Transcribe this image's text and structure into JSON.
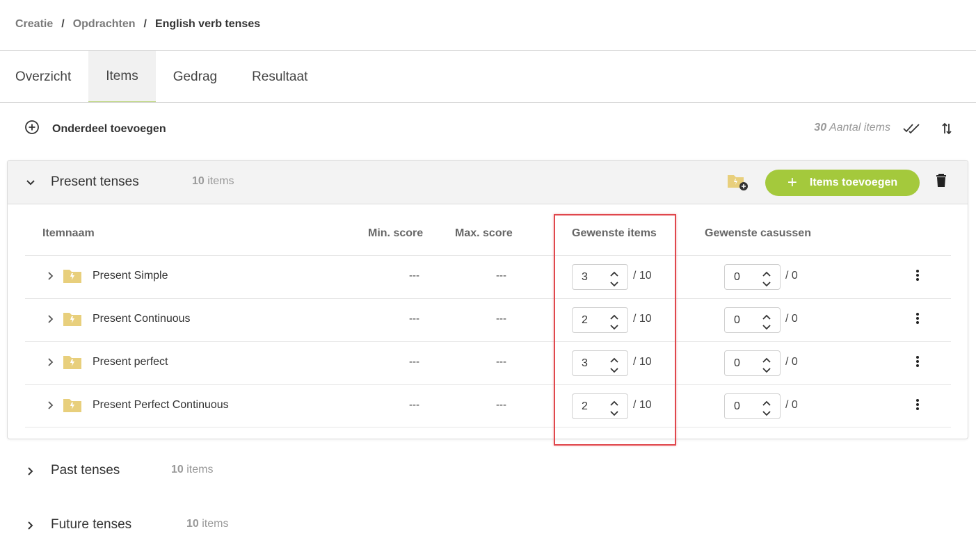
{
  "breadcrumb": {
    "items": [
      "Creatie",
      "Opdrachten",
      "English verb tenses"
    ],
    "separator": "/"
  },
  "tabs": [
    "Overzicht",
    "Items",
    "Gedrag",
    "Resultaat"
  ],
  "active_tab": "Items",
  "toolbar": {
    "add_section_label": "Onderdeel toevoegen",
    "item_count": "30",
    "item_count_label": "Aantal items"
  },
  "sections": [
    {
      "title": "Present tenses",
      "count": "10",
      "count_label": "items",
      "expanded": true,
      "add_items_label": "Items toevoegen",
      "columns": [
        "Itemnaam",
        "Min. score",
        "Max. score",
        "Gewenste items",
        "Gewenste casussen"
      ],
      "rows": [
        {
          "name": "Present Simple",
          "min": "---",
          "max": "---",
          "items_val": "3",
          "items_total": "/ 10",
          "cases_val": "0",
          "cases_total": "/ 0"
        },
        {
          "name": "Present Continuous",
          "min": "---",
          "max": "---",
          "items_val": "2",
          "items_total": "/ 10",
          "cases_val": "0",
          "cases_total": "/ 0"
        },
        {
          "name": "Present perfect",
          "min": "---",
          "max": "---",
          "items_val": "3",
          "items_total": "/ 10",
          "cases_val": "0",
          "cases_total": "/ 0"
        },
        {
          "name": "Present Perfect Continuous",
          "min": "---",
          "max": "---",
          "items_val": "2",
          "items_total": "/ 10",
          "cases_val": "0",
          "cases_total": "/ 0"
        }
      ]
    },
    {
      "title": "Past tenses",
      "count": "10",
      "count_label": "items",
      "expanded": false
    },
    {
      "title": "Future tenses",
      "count": "10",
      "count_label": "items",
      "expanded": false
    }
  ],
  "colors": {
    "accent_green": "#a4c93c",
    "folder_yellow": "#e8cf7c",
    "highlight_red": "#e0474c"
  },
  "icons": [
    "plus-circle-icon",
    "double-check-icon",
    "sort-icon",
    "chevron-down-icon",
    "chevron-right-icon",
    "folder-add-icon",
    "trash-icon",
    "folder-icon",
    "caret-up-icon",
    "caret-down-icon",
    "kebab-menu-icon"
  ]
}
